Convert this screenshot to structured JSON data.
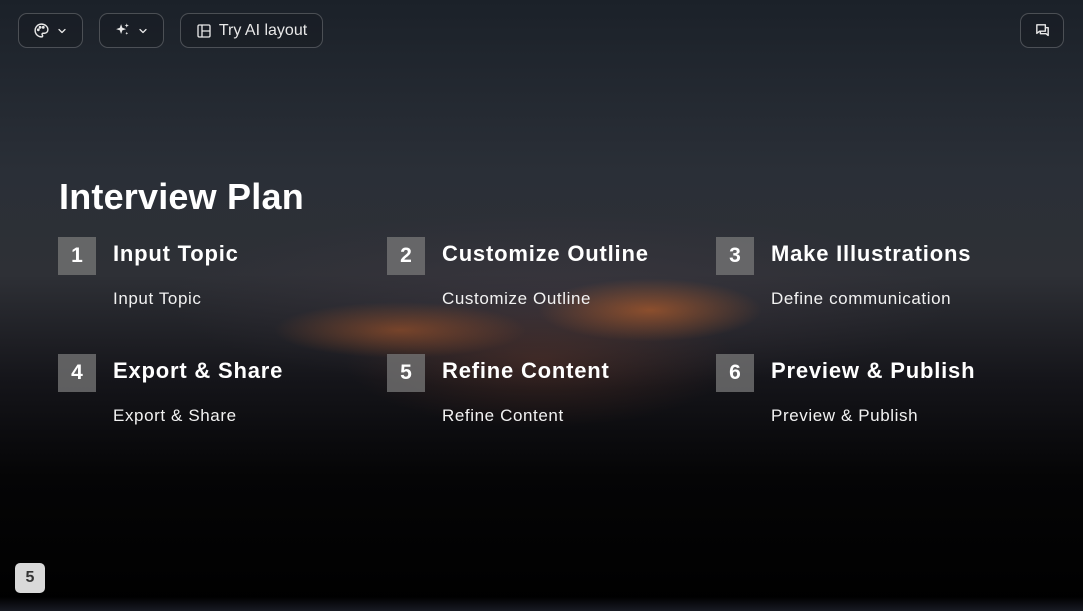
{
  "toolbar": {
    "theme_icon": "palette-icon",
    "ai_icon": "sparkles-icon",
    "layout_label": "Try AI layout",
    "layout_icon": "layout-icon",
    "chat_icon": "chat-icon"
  },
  "slide": {
    "title": "Interview Plan",
    "steps": [
      {
        "number": "1",
        "heading": "Input Topic",
        "description": "Input Topic"
      },
      {
        "number": "2",
        "heading": "Customize Outline",
        "description": "Customize Outline"
      },
      {
        "number": "3",
        "heading": "Make Illustrations",
        "description": "Define communication"
      },
      {
        "number": "4",
        "heading": "Export & Share",
        "description": "Export & Share"
      },
      {
        "number": "5",
        "heading": "Refine Content",
        "description": "Refine Content"
      },
      {
        "number": "6",
        "heading": "Preview & Publish",
        "description": "Preview & Publish"
      }
    ]
  },
  "page_number": "5",
  "colors": {
    "number_badge": "#787878",
    "page_badge": "#d9d9d9"
  }
}
